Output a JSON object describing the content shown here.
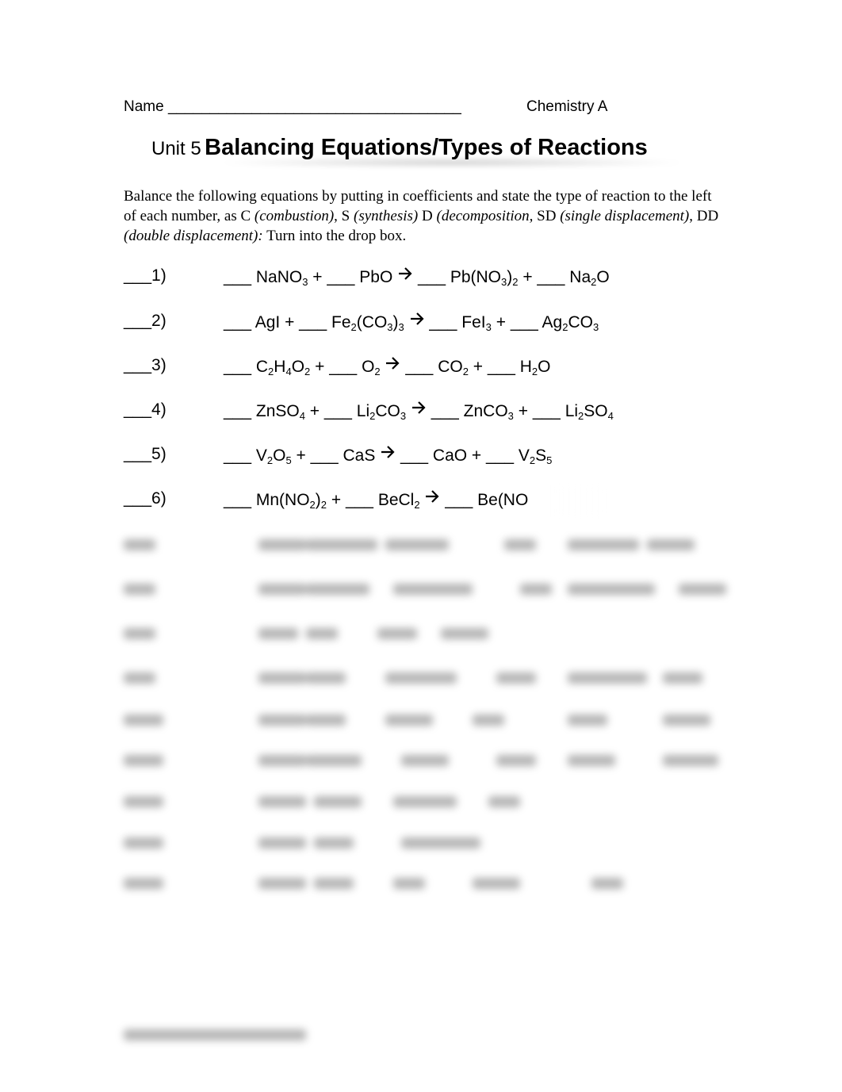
{
  "header": {
    "name_label": "Name ___________________________________",
    "course": "Chemistry A"
  },
  "title": {
    "unit": "Unit 5",
    "main": "Balancing Equations/Types of Reactions"
  },
  "instructions": {
    "part1": "Balance the following equations by putting in coefficients and state the type of reaction to the left of each number, as C ",
    "combustion": "(combustion)",
    "part2": ", S ",
    "synthesis": "(synthesis)",
    "part3": " D ",
    "decomposition": "(decomposition,",
    "part4": " SD ",
    "single": "(single displacement)",
    "part5": ", DD ",
    "double": "(double displacement):",
    "part6": " Turn into the drop box."
  },
  "equations": [
    {
      "num": "___1)",
      "html": "___ NaNO<sub>3</sub> + ___ PbO {ARROW} ___ Pb(NO<sub>3</sub>)<sub>2</sub> + ___ Na<sub>2</sub>O"
    },
    {
      "num": "___2)",
      "html": "___ AgI + ___ Fe<sub>2</sub>(CO<sub>3</sub>)<sub>3</sub> {ARROW} ___ FeI<sub>3</sub> + ___ Ag<sub>2</sub>CO<sub>3</sub>"
    },
    {
      "num": "___3)",
      "html": "___ C<sub>2</sub>H<sub>4</sub>O<sub>2</sub> + ___ O<sub>2</sub> {ARROW} ___ CO<sub>2</sub> + ___ H<sub>2</sub>O"
    },
    {
      "num": "___4)",
      "html": "___ ZnSO<sub>4</sub> + ___ Li<sub>2</sub>CO<sub>3</sub> {ARROW} ___ ZnCO<sub>3</sub> + ___ Li<sub>2</sub>SO<sub>4</sub>"
    },
    {
      "num": "___5)",
      "html": "___ V<sub>2</sub>O<sub>5</sub> + ___ CaS {ARROW} ___ CaO + ___ V<sub>2</sub>S<sub>5</sub>"
    },
    {
      "num": "___6)",
      "html": "___ Mn(NO<sub>2</sub>)<sub>2</sub> + ___ BeCl<sub>2</sub> {ARROW} ___ Be(NO"
    }
  ],
  "icons": {
    "reaction_arrow": "right-arrow-icon"
  }
}
